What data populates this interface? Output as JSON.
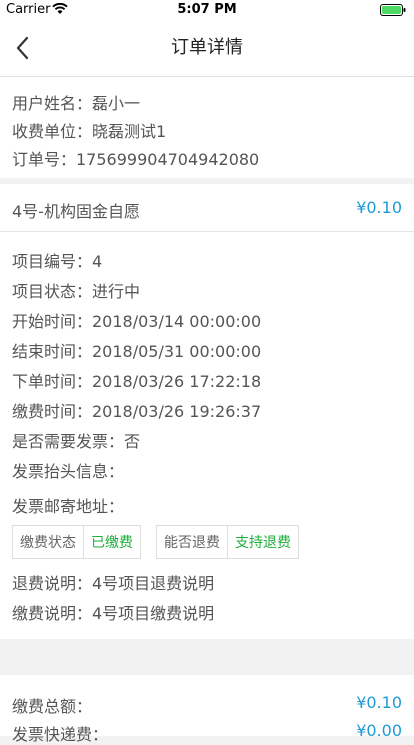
{
  "status_bar": {
    "carrier": "Carrier",
    "time": "5:07 PM"
  },
  "nav": {
    "title": "订单详情"
  },
  "user_info": [
    "用户姓名：磊小一",
    "收费单位：晓磊测试1",
    "订单号：17569990470494208​0"
  ],
  "project": {
    "name": "4号-机构固金自愿",
    "price": "¥0.10"
  },
  "details": [
    "项目编号：4",
    "项目状态：进行中",
    "开始时间：2018/03/14 00:00:00",
    "结束时间：2018/05/31 00:00:00",
    "下单时间：2018/03/26 17:22:18",
    "缴费时间：2018/03/26 19:26:37",
    "是否需要发票：否",
    "发票抬头信息：",
    "发票邮寄地址："
  ],
  "tags": [
    {
      "label": "缴费状态",
      "value": "已缴费"
    },
    {
      "label": "能否退费",
      "value": "支持退费"
    }
  ],
  "notes": [
    "退费说明：4号项目退费说明",
    "缴费说明：4号项目缴费说明"
  ],
  "totals": [
    {
      "label": "缴费总额：",
      "value": "¥0.10"
    },
    {
      "label": "发票快递费：",
      "value": "¥0.00"
    }
  ],
  "colors": {
    "accent": "#1e9bd7",
    "success": "#1fae3a",
    "background": "#f2f2f2"
  }
}
